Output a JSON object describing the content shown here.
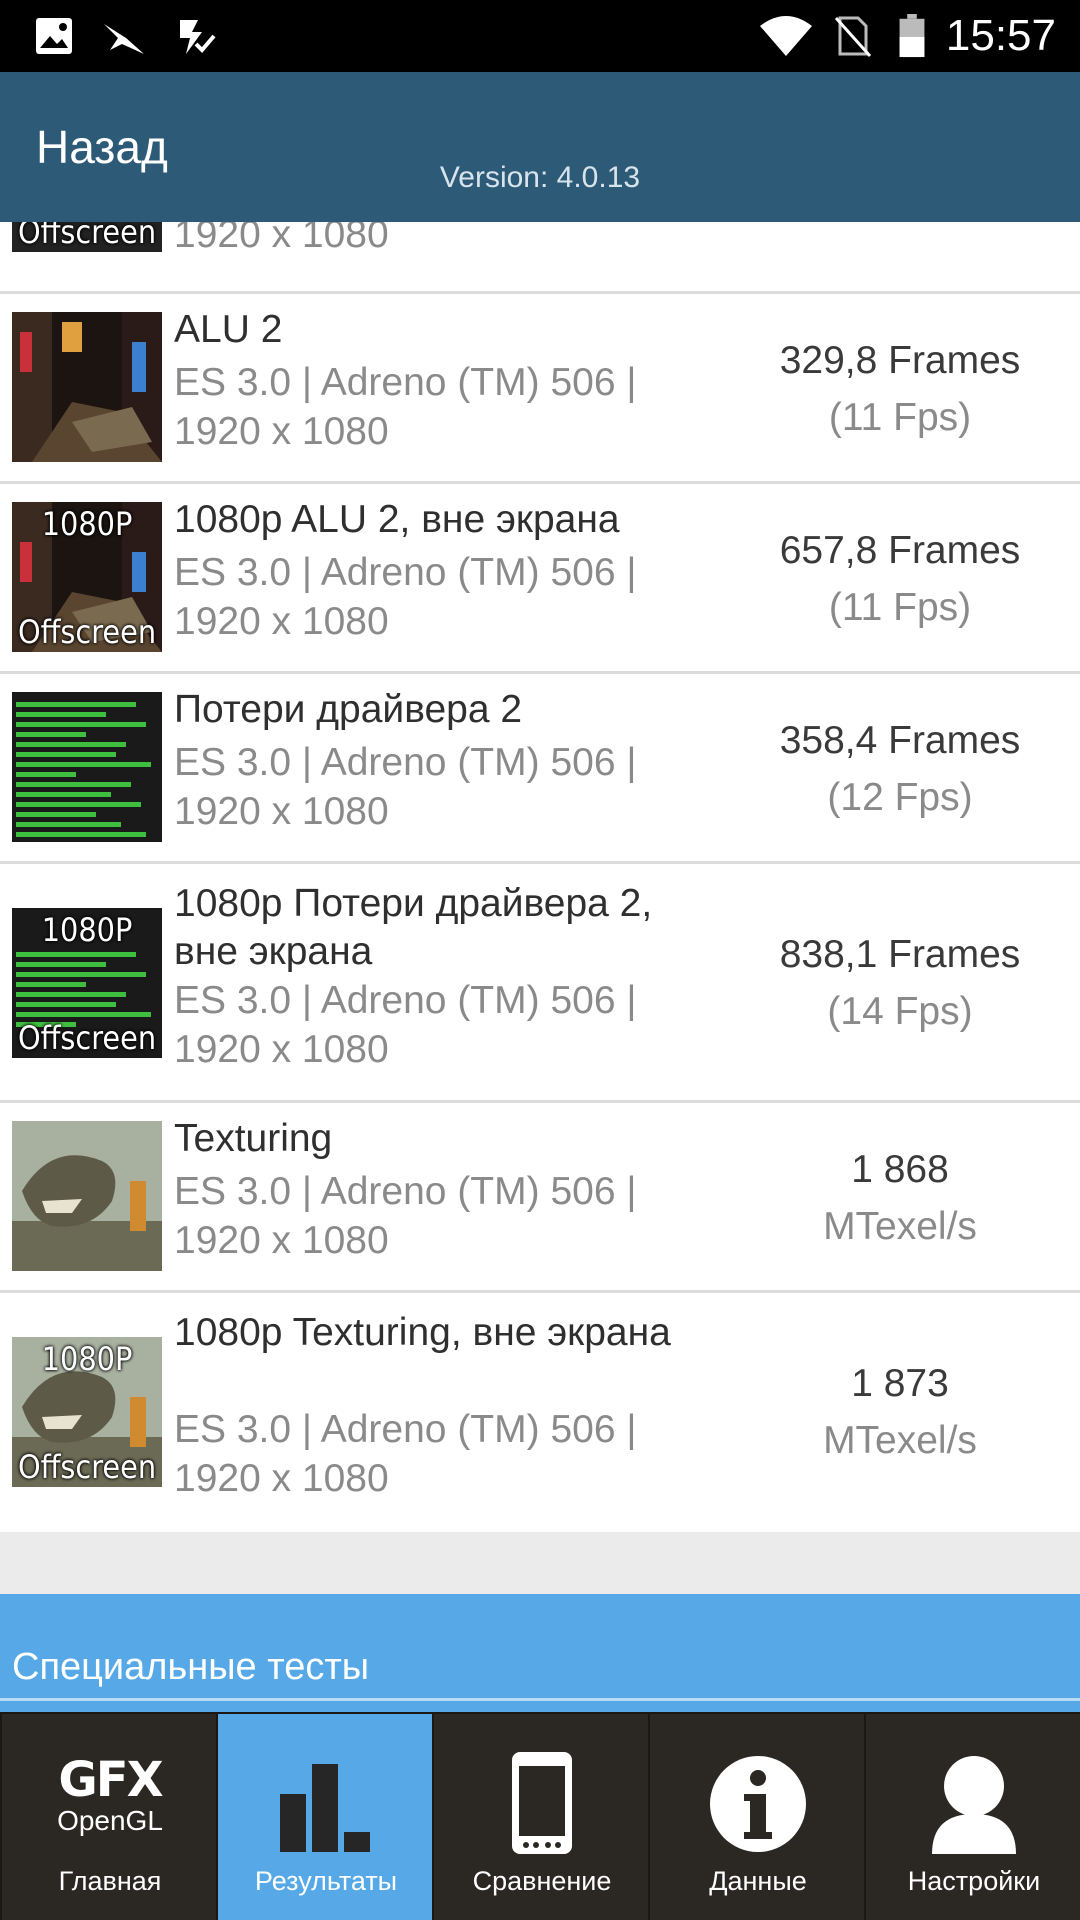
{
  "status_bar": {
    "time": "15:57"
  },
  "header": {
    "back_label": "Назад",
    "version": "Version: 4.0.13"
  },
  "results": [
    {
      "title": "",
      "sub": "1920 x 1080",
      "value": "",
      "unit": "",
      "thumb": [
        "",
        "Offscreen"
      ]
    },
    {
      "title": "ALU 2",
      "sub": "ES 3.0 | Adreno (TM) 506 | 1920 x 1080",
      "value": "329,8 Frames",
      "unit": "(11 Fps)",
      "thumb": [
        "",
        ""
      ]
    },
    {
      "title": "1080p ALU 2, вне экрана",
      "sub": "ES 3.0 | Adreno (TM) 506 | 1920 x 1080",
      "value": "657,8 Frames",
      "unit": "(11 Fps)",
      "thumb": [
        "1080P",
        "Offscreen"
      ]
    },
    {
      "title": "Потери драйвера 2",
      "sub": "ES 3.0 | Adreno (TM) 506 | 1920 x 1080",
      "value": "358,4 Frames",
      "unit": "(12 Fps)",
      "thumb": [
        "",
        ""
      ]
    },
    {
      "title": "1080p Потери драйвера 2, вне экрана",
      "sub": "ES 3.0 | Adreno (TM) 506 | 1920 x 1080",
      "value": "838,1 Frames",
      "unit": "(14 Fps)",
      "thumb": [
        "1080P",
        "Offscreen"
      ]
    },
    {
      "title": "Texturing",
      "sub": "ES 3.0 | Adreno (TM) 506 | 1920 x 1080",
      "value": "1 868",
      "unit": "MTexel/s",
      "thumb": [
        "",
        ""
      ]
    },
    {
      "title": "1080p Texturing, вне экрана",
      "sub": "ES 3.0 | Adreno (TM) 506 | 1920 x 1080",
      "value": "1 873",
      "unit": "MTexel/s",
      "thumb": [
        "1080P",
        "Offscreen"
      ]
    }
  ],
  "special_section": {
    "title": "Специальные тесты"
  },
  "bottom_nav": {
    "gfx_logo": "GFX",
    "gfx_logo_sub": "OpenGL",
    "items": [
      {
        "label": "Главная",
        "icon": "gfx-logo-icon"
      },
      {
        "label": "Результаты",
        "icon": "bar-chart-icon"
      },
      {
        "label": "Сравнение",
        "icon": "phone-icon"
      },
      {
        "label": "Данные",
        "icon": "info-icon"
      },
      {
        "label": "Настройки",
        "icon": "person-icon"
      }
    ]
  },
  "colors": {
    "header": "#2d5a76",
    "accent": "#56a9e6",
    "nav_bg": "#2b2723"
  }
}
